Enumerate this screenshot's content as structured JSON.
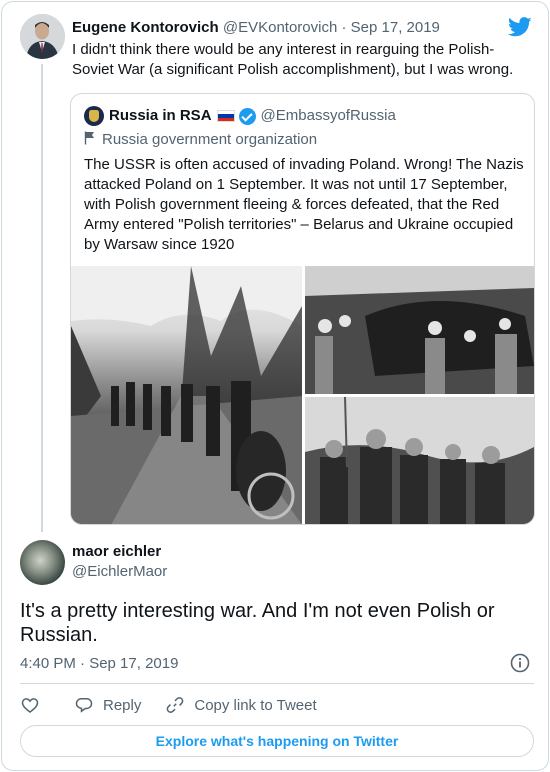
{
  "parent_tweet": {
    "name": "Eugene Kontorovich",
    "handle": "@EVKontorovich",
    "separator": "·",
    "date": "Sep 17, 2019",
    "text": "I didn't think there would be any interest in rearguing the Polish-Soviet War (a significant Polish accomplishment), but I was wrong."
  },
  "quoted_tweet": {
    "name": "Russia in RSA",
    "flag_colors": [
      "#ffffff",
      "#0039a6",
      "#d52b1e"
    ],
    "verified": true,
    "handle": "@EmbassyofRussia",
    "org_label": "Russia government organization",
    "text": "The USSR is often accused of invading Poland. Wrong! The Nazis attacked Poland on 1 September. It was not until 17 September, with Polish government fleeing & forces defeated, that the Red Army entered \"Polish territories\" – Belarus and Ukraine occupied by Warsaw since 1920",
    "photos": [
      "soldiers-marching-road-photo",
      "crowd-greeting-tank-photo",
      "soldiers-with-villagers-photo"
    ]
  },
  "reply_tweet": {
    "name": "maor eichler",
    "handle": "@EichlerMaor",
    "text": "It's a pretty interesting war. And I'm not even Polish or Russian.",
    "timestamp": "4:40 PM · Sep 17, 2019"
  },
  "actions": {
    "like_icon": "heart-icon",
    "reply_label": "Reply",
    "copy_label": "Copy link to Tweet"
  },
  "footer": {
    "explore_label": "Explore what's happening on Twitter"
  },
  "colors": {
    "accent": "#1d9bf0",
    "text": "#0f1419",
    "secondary": "#536471",
    "border": "#cfd9de"
  }
}
